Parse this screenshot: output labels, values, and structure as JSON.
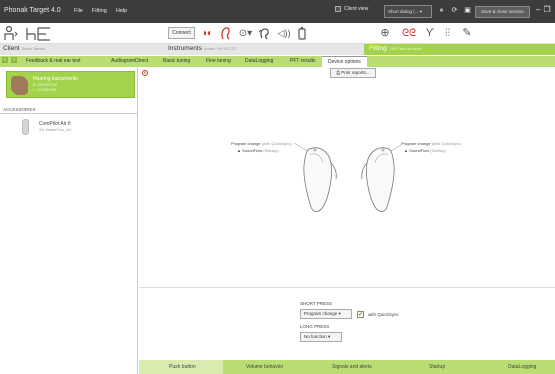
{
  "titlebar": {
    "app_name": "Phonak Target 4.0",
    "menu": [
      "File",
      "Fitting",
      "Help"
    ],
    "client_view": "Client view",
    "dialog": "Short dialog (...",
    "save_close": "Save & close session"
  },
  "toolbar": {
    "connect": "Connect"
  },
  "header": {
    "client": "Client",
    "client_sub": "Smith James",
    "instruments": "Instruments",
    "instruments_sub": "Audéo YM 90-13T",
    "fitting": "Fitting",
    "fitting_sub": "Off Cadx situation"
  },
  "tabs": [
    {
      "label": "Feedback & real ear test"
    },
    {
      "label": "AudiogramDirect"
    },
    {
      "label": "Basic tuning"
    },
    {
      "label": "Fine tuning"
    },
    {
      "label": "DataLogging"
    },
    {
      "label": "PFT results"
    },
    {
      "label": "Device options"
    }
  ],
  "left": {
    "hi_title": "Hearing instruments",
    "hi_right": "R: 1847857096",
    "hi_left": "L: 1647857096",
    "accessories_heading": "ACCESSORIES",
    "acc_name": "ComPilot Air II",
    "acc_sub": "SN: MasterCom_0x2"
  },
  "main": {
    "marker": "B",
    "print_reports": "Print reports...",
    "left_program": "Program change",
    "left_program_sub": "(with QuickSync)",
    "left_soundflow": "SoundFlow",
    "left_soundflow_sub": "(Startup)",
    "right_program": "Program change",
    "right_program_sub": "(with QuickSync)",
    "right_soundflow": "SoundFlow",
    "right_soundflow_sub": "(Startup)",
    "short_press_heading": "SHORT PRESS",
    "short_press_value": "Program change",
    "quicksync_label": "with QuickSync",
    "long_press_heading": "LONG PRESS",
    "long_press_value": "No function"
  },
  "bottom_tabs": [
    {
      "label": "Push button"
    },
    {
      "label": "Volume behavior"
    },
    {
      "label": "Signals and alerts"
    },
    {
      "label": "Startup"
    },
    {
      "label": "DataLogging"
    }
  ],
  "colors": {
    "accent_green": "#a3d34c",
    "tab_green": "#b9dd72",
    "titlebar": "#3c3c3c",
    "icon_red": "#d0352c"
  }
}
